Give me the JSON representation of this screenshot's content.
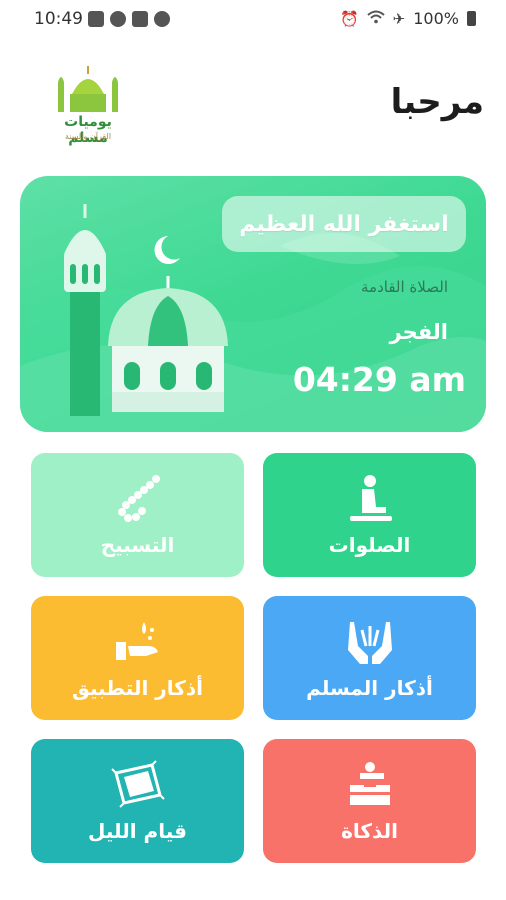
{
  "status_bar": {
    "time": "10:49",
    "battery": "100%"
  },
  "logo": {
    "title": "يوميات مسلم",
    "subtitle": "القرآن والسنة"
  },
  "greeting": "مرحبا",
  "hero": {
    "zikr": "استغفر الله العظيم",
    "next_prayer_label": "الصلاة القادمة",
    "prayer_name": "الفجر",
    "prayer_time": "04:29 am"
  },
  "tiles": [
    {
      "label": "الصلوات",
      "icon": "praying-person-icon",
      "color": "#2fd38c"
    },
    {
      "label": "التسبيح",
      "icon": "prayer-beads-icon",
      "color": "#9ff0c7"
    },
    {
      "label": "أذكار المسلم",
      "icon": "praying-hands-icon",
      "color": "#4aa8f5"
    },
    {
      "label": "أذكار التطبيق",
      "icon": "hand-water-icon",
      "color": "#fcbc32"
    },
    {
      "label": "الذكاة",
      "icon": "charity-box-icon",
      "color": "#f9726a"
    },
    {
      "label": "قيام الليل",
      "icon": "prayer-mat-icon",
      "color": "#22b3b3"
    }
  ]
}
